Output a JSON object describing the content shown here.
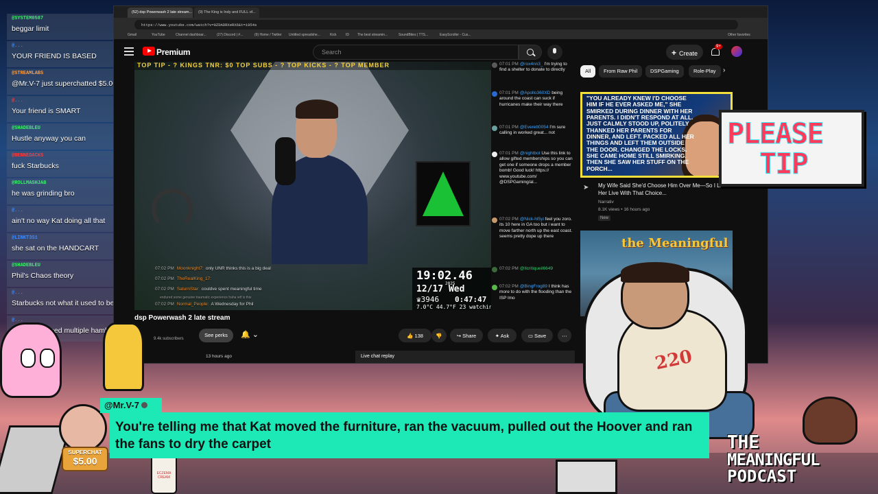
{
  "chat_overlay": {
    "messages": [
      {
        "user": "@SYSTEM0587",
        "user_color": "#3af06a",
        "text": "beggar limit"
      },
      {
        "user": "@...",
        "user_color": "#3a8aff",
        "text": "YOUR FRIEND IS BASED"
      },
      {
        "user": "@STREAMLABS",
        "user_color": "#ff9a3a",
        "text": "@Mr.V-7 just superchatted $5.00!"
      },
      {
        "user": "@...",
        "user_color": "#ff3a3a",
        "text": "Your friend is SMART"
      },
      {
        "user": "@SHADEBLEU",
        "user_color": "#3af06a",
        "text": "Hustle anyway you can"
      },
      {
        "user": "@BENNEDACKS",
        "user_color": "#ff3a3a",
        "text": "fuck Starbucks"
      },
      {
        "user": "@ROLLMASHJAB",
        "user_color": "#3af06a",
        "text": "he was grinding bro"
      },
      {
        "user": "@...",
        "user_color": "#3a8aff",
        "text": "ain't no way Kat doing all that"
      },
      {
        "user": "@LINKT3S1",
        "user_color": "#3a8aff",
        "text": "she sat on the HANDCART"
      },
      {
        "user": "@SHADEBLEU",
        "user_color": "#3af06a",
        "text": "Phil's Chaos theory"
      },
      {
        "user": "@...",
        "user_color": "#3a8aff",
        "text": "Starbucks not what it used to be"
      },
      {
        "user": "@...",
        "user_color": "#3a8aff",
        "text": "she would need multiple hamburger sessions"
      }
    ]
  },
  "browser": {
    "tabs": [
      "(52) dsp Powerwash 2 late stream...",
      "(9) The King is Indy and FULL of..."
    ],
    "url": "https://www.youtube.com/watch?v=0ZDADRXeRX6&t=1954s",
    "bookmarks": [
      "Gmail",
      "YouTube",
      "Channel dashboar...",
      "(27) Discord | #...",
      "(9) Home / Twitter",
      "Untitled spreadshe...",
      "Kick",
      "ID",
      "The best streamin...",
      "SoundBites | TTS...",
      "EasyScroller - Cus..."
    ],
    "other_bookmarks": "Other favorites"
  },
  "youtube_header": {
    "brand": "Premium",
    "search_placeholder": "Search",
    "create_label": "Create",
    "notification_count": "9+"
  },
  "player": {
    "banner_text": "TOP TIP - ?   KINGS TNR: $0   TOP SUBS - ?   TOP KICKS - ?   TOP MEMBER",
    "overlay_chat": [
      {
        "time": "07:02 PM",
        "name": "Moonknight7:",
        "text": "only UNR thinks this is a big deal"
      },
      {
        "time": "07:02 PM",
        "name": "TheRealKing_17:",
        "text": ""
      },
      {
        "time": "07:02 PM",
        "name": "SaturnStar:",
        "text": "couldve spent meaningful time"
      },
      {
        "time": "",
        "name": "",
        "text": "endured some genuine traumatic experience haha wtf is this"
      },
      {
        "time": "07:02 PM",
        "name": "Normal_People:",
        "text": "A Wednesday for Phil"
      }
    ],
    "clock": {
      "time": "19:02.46",
      "year": "2025",
      "date": "12/17 Wed",
      "crown_count": "♛3946",
      "timer": "0:47:47",
      "weather": "7.0°C  44.7°F",
      "watching": "23 watching n"
    }
  },
  "live_chat": {
    "messages": [
      {
        "time": "07:01 PM",
        "user": "@rox4nn3_",
        "text": "I'm trying to find a shelter to donate to directly"
      },
      {
        "time": "07:01 PM",
        "user": "@Apollo360XD",
        "text": "being around the coast can suck if hurricanes make their way there"
      },
      {
        "time": "07:01 PM",
        "user": "@Everett0054",
        "text": "I'm sure calling in worked great... not"
      },
      {
        "time": "07:01 PM",
        "user": "@nightbot",
        "text": "Use this link to allow gifted memberships so you can get one if someone drops a member bomb! Good luck! https:// www.youtube.com/ @DSPGaming/al..."
      },
      {
        "time": "07:02 PM",
        "user": "@Nick-ht5yi",
        "text": "feel you zoro. its 10 here in GA too but i want to move farther north up the east coast. seems pretty dope up there"
      },
      {
        "time": "07:02 PM",
        "user": "@Ilcritiqueil6649",
        "text": ""
      },
      {
        "time": "07:02 PM",
        "user": "@BingFrog89",
        "text": "I think has more to do with the flooding than the ISP lmo"
      }
    ]
  },
  "video_info": {
    "title": "dsp Powerwash 2 late stream",
    "subscribers": "9.4k subscribers",
    "see_perks": "See perks",
    "likes": "138",
    "share": "Share",
    "ask": "Ask",
    "save": "Save",
    "time_ago": "13 hours ago",
    "live_chat_replay": "Live chat replay"
  },
  "sidebar": {
    "chips": [
      "All",
      "From Raw Phil",
      "DSPGaming",
      "Role-Play"
    ],
    "video1": {
      "thumbnail_text": "\"YOU ALREADY KNEW I'D CHOOSE HIM IF HE EVER ASKED ME,\" SHE SMIRKED DURING DINNER WITH HER PARENTS. I DIDN'T RESPOND AT ALL. JUST CALMLY STOOD UP, POLITELY THANKED HER PARENTS FOR DINNER, AND LEFT. PACKED ALL HER THINGS AND LEFT THEM OUTSIDE THE DOOR. CHANGED THE LOCKS. SHE CAME HOME STILL SMIRKING. THEN SHE SAW HER STUFF ON THE PORCH...",
      "title": "My Wife Said She'd Choose Him Over Me—So I Let Her Live With That Choice...",
      "channel": "Narrativ",
      "stats": "8.1K views • 16 hours ago",
      "badge": "New"
    },
    "video2": {
      "thumbnail_logo": "the Meaningful"
    }
  },
  "please_tip": {
    "line1": "PLEASE",
    "line2": "TIP"
  },
  "mascot": {
    "number": "220"
  },
  "spray_can_label": "ECZEMA CREAM",
  "superchat": {
    "user": "@Mr.V-7",
    "message": "You're telling me that Kat moved the furniture, ran the vacuum, pulled out the Hoover and ran the fans to dry the carpet",
    "badge_label": "SUPERCHAT",
    "amount": "$5.00"
  },
  "podcast_logo": {
    "line1": "THE",
    "line2": "MEANINGFUL",
    "line3": "PODCAST"
  },
  "colors": {
    "superchat_bg": "#1de9b6",
    "yt_red": "#ff0000",
    "yt_bg": "#0f0f0f",
    "tip_text": "#ff3a5a",
    "tip_stroke": "#3af0ff"
  }
}
